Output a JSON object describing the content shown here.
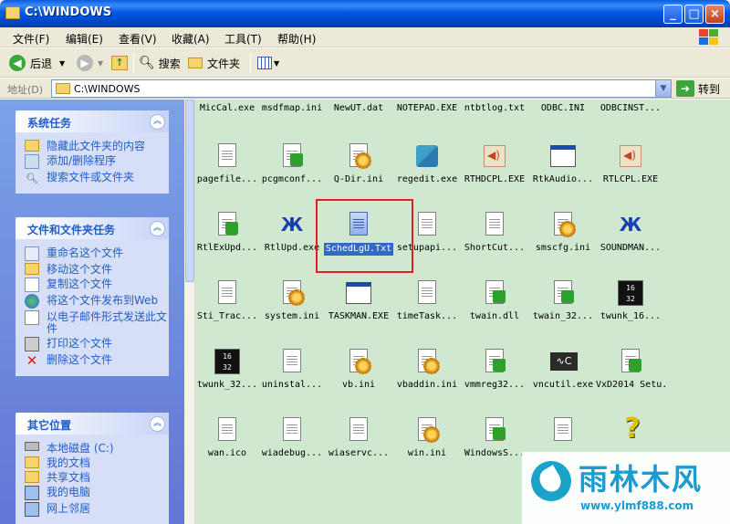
{
  "window": {
    "title": "C:\\WINDOWS",
    "minimize": "_",
    "maximize": "□",
    "close": "×"
  },
  "menu": [
    "文件(F)",
    "编辑(E)",
    "查看(V)",
    "收藏(A)",
    "工具(T)",
    "帮助(H)"
  ],
  "toolbar": {
    "back": "后退",
    "search": "搜索",
    "folders": "文件夹"
  },
  "address": {
    "label": "地址(D)",
    "value": "C:\\WINDOWS",
    "go": "转到"
  },
  "system_tasks": {
    "title": "系统任务",
    "items": [
      "隐藏此文件夹的内容",
      "添加/删除程序",
      "搜索文件或文件夹"
    ]
  },
  "file_tasks": {
    "title": "文件和文件夹任务",
    "items": [
      "重命名这个文件",
      "移动这个文件",
      "复制这个文件",
      "将这个文件发布到Web",
      "以电子邮件形式发送此文件",
      "打印这个文件",
      "删除这个文件"
    ]
  },
  "other_places": {
    "title": "其它位置",
    "items": [
      "本地磁盘 (C:)",
      "我的文档",
      "共享文档",
      "我的电脑",
      "网上邻居"
    ]
  },
  "files": [
    {
      "name": "MicCal.exe",
      "icon": "none"
    },
    {
      "name": "msdfmap.ini",
      "icon": "none"
    },
    {
      "name": "NewUT.dat",
      "icon": "none"
    },
    {
      "name": "NOTEPAD.EXE",
      "icon": "none"
    },
    {
      "name": "ntbtlog.txt",
      "icon": "none"
    },
    {
      "name": "ODBC.INI",
      "icon": "none"
    },
    {
      "name": "ODBCINST...",
      "icon": "none"
    },
    {
      "name": "pagefile...",
      "icon": "doc-text"
    },
    {
      "name": "pcgmconf...",
      "icon": "doc-green"
    },
    {
      "name": "Q-Dir.ini",
      "icon": "doc-gear"
    },
    {
      "name": "regedit.exe",
      "icon": "cubes"
    },
    {
      "name": "RTHDCPL.EXE",
      "icon": "speaker"
    },
    {
      "name": "RtkAudio...",
      "icon": "window"
    },
    {
      "name": "RTLCPL.EXE",
      "icon": "speaker"
    },
    {
      "name": "RtlExUpd...",
      "icon": "doc-green"
    },
    {
      "name": "RtlUpd.exe",
      "icon": "crab"
    },
    {
      "name": "SchedLgU.Txt",
      "icon": "doc-blue"
    },
    {
      "name": "setupapi...",
      "icon": "doc-text"
    },
    {
      "name": "ShortCut...",
      "icon": "doc-text"
    },
    {
      "name": "smscfg.ini",
      "icon": "doc-gear"
    },
    {
      "name": "SOUNDMAN...",
      "icon": "crab"
    },
    {
      "name": "Sti_Trac...",
      "icon": "doc-text"
    },
    {
      "name": "system.ini",
      "icon": "doc-gear"
    },
    {
      "name": "TASKMAN.EXE",
      "icon": "window"
    },
    {
      "name": "timeTask...",
      "icon": "doc-text"
    },
    {
      "name": "twain.dll",
      "icon": "doc-green"
    },
    {
      "name": "twain_32...",
      "icon": "doc-green"
    },
    {
      "name": "twunk_16...",
      "icon": "1632"
    },
    {
      "name": "twunk_32...",
      "icon": "1632"
    },
    {
      "name": "uninstal...",
      "icon": "doc-text"
    },
    {
      "name": "vb.ini",
      "icon": "doc-gear"
    },
    {
      "name": "vbaddin.ini",
      "icon": "doc-gear"
    },
    {
      "name": "vmmreg32...",
      "icon": "doc-green"
    },
    {
      "name": "vncutil.exe",
      "icon": "osc"
    },
    {
      "name": "VxD2014 Setu...",
      "icon": "doc-green"
    },
    {
      "name": "wan.ico",
      "icon": "doc-text"
    },
    {
      "name": "wiadebug...",
      "icon": "doc-text"
    },
    {
      "name": "wiaservc...",
      "icon": "doc-text"
    },
    {
      "name": "win.ini",
      "icon": "doc-gear"
    },
    {
      "name": "WindowsS...",
      "icon": "doc-green"
    },
    {
      "name": "",
      "icon": "doc-text"
    },
    {
      "name": "",
      "icon": "help"
    }
  ],
  "selected_file": "SchedLgU.Txt",
  "watermark": {
    "brand": "雨林木风",
    "url": "www.ylmf888.com"
  }
}
